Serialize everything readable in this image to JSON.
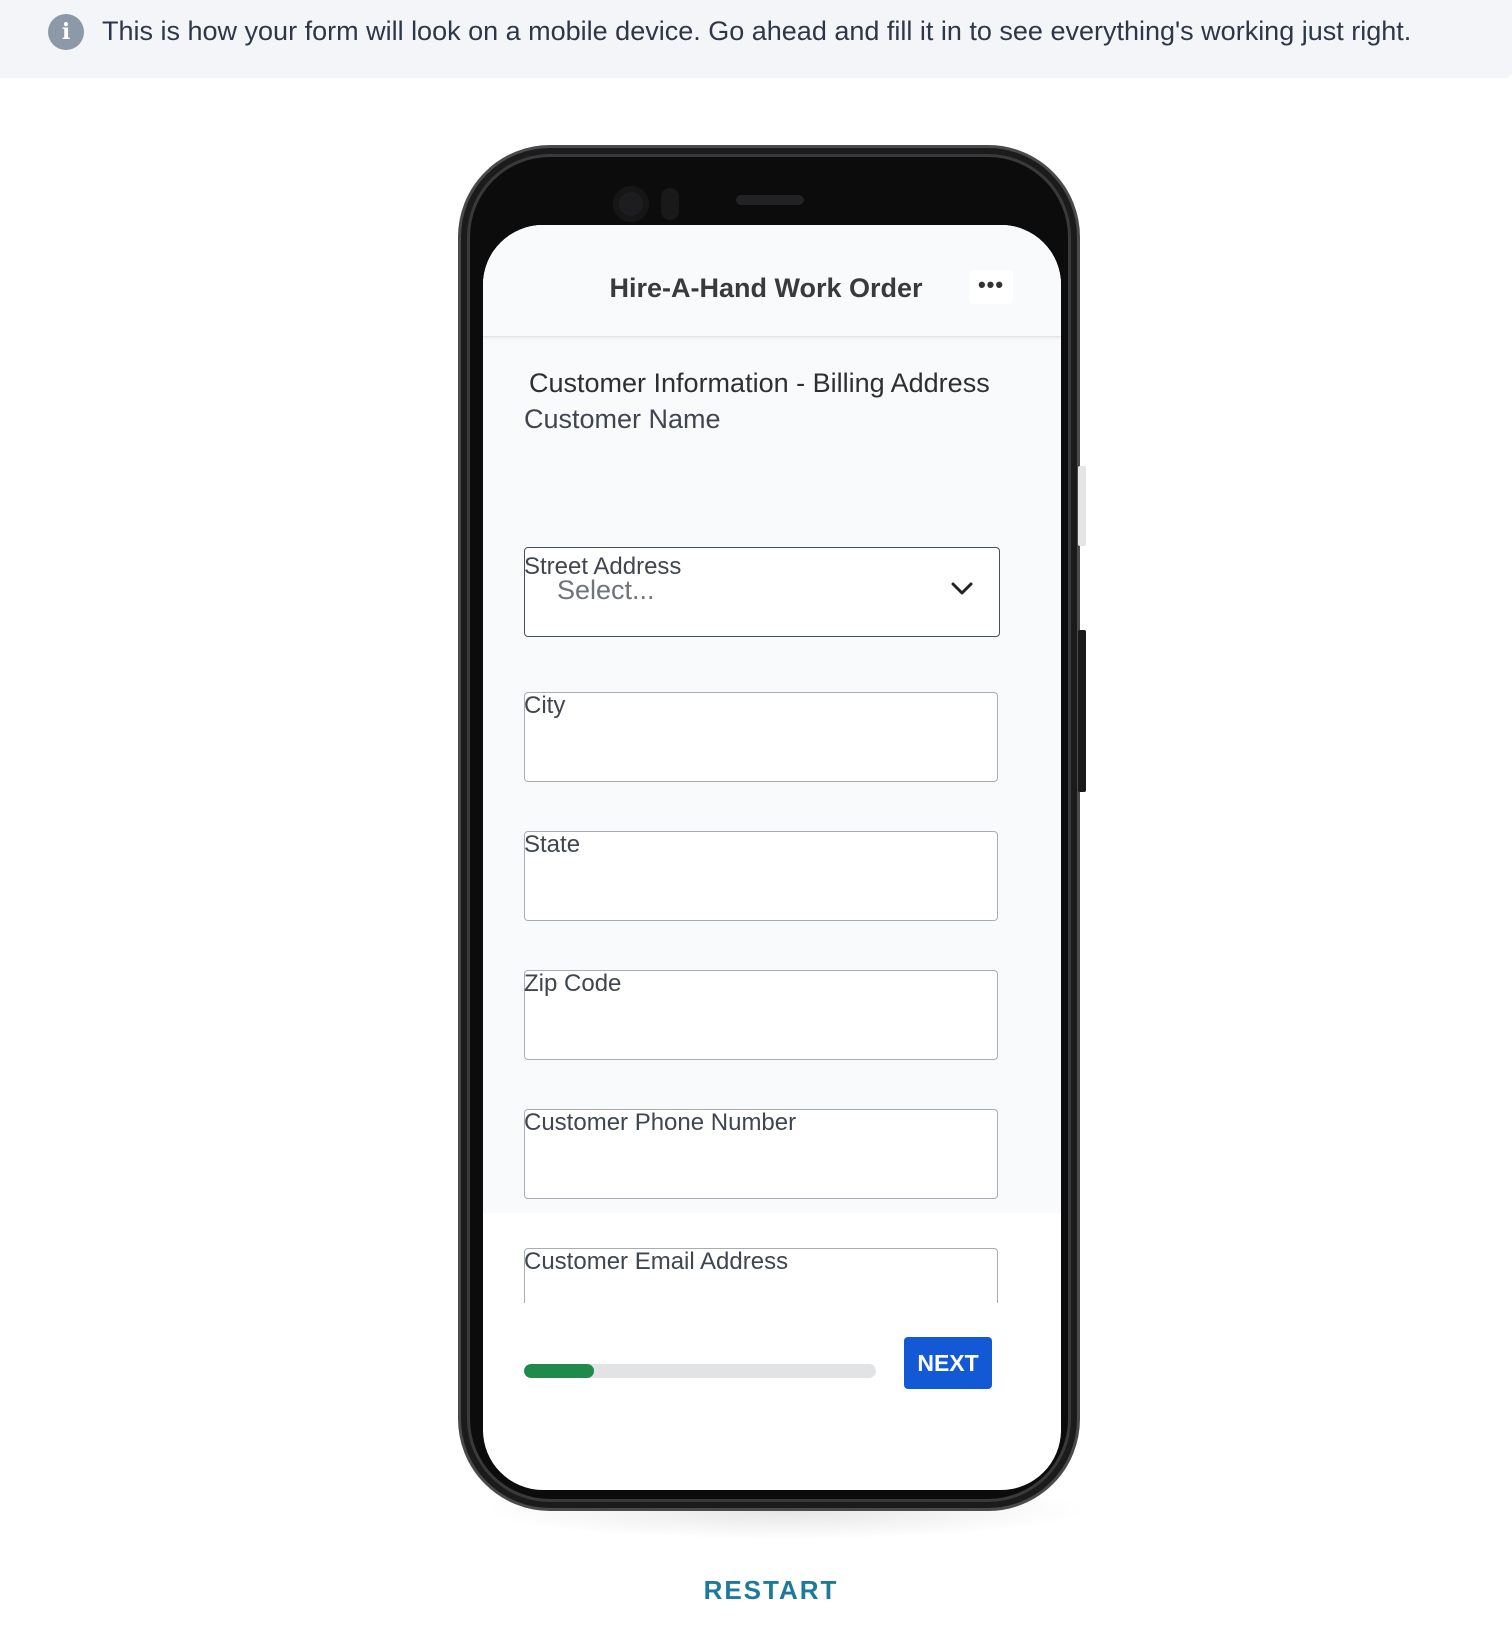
{
  "banner": {
    "icon": "info-icon",
    "icon_glyph": "i",
    "text": "This is how your form will look on a mobile device. Go ahead and fill it in to see everything's working just right."
  },
  "app": {
    "title": "Hire-A-Hand Work Order",
    "menu_icon": "more-horizontal-icon",
    "menu_glyph": "•••"
  },
  "form": {
    "section_heading": "Customer Information - Billing Address",
    "customer_name": {
      "label": "Customer Name",
      "placeholder": "Select..."
    },
    "fields": [
      {
        "label": "Street Address",
        "value": ""
      },
      {
        "label": "City",
        "value": ""
      },
      {
        "label": "State",
        "value": ""
      },
      {
        "label": "Zip Code",
        "value": ""
      },
      {
        "label": "Customer Phone Number",
        "value": ""
      },
      {
        "label": "Customer Email Address",
        "value": ""
      }
    ]
  },
  "footer": {
    "progress_fraction": 0.2,
    "next_label": "NEXT"
  },
  "restart_label": "RESTART",
  "colors": {
    "accent_blue": "#1358d4",
    "progress_green": "#1f8a4c",
    "restart_teal": "#1e7a9c",
    "banner_bg": "#f3f5f9"
  }
}
